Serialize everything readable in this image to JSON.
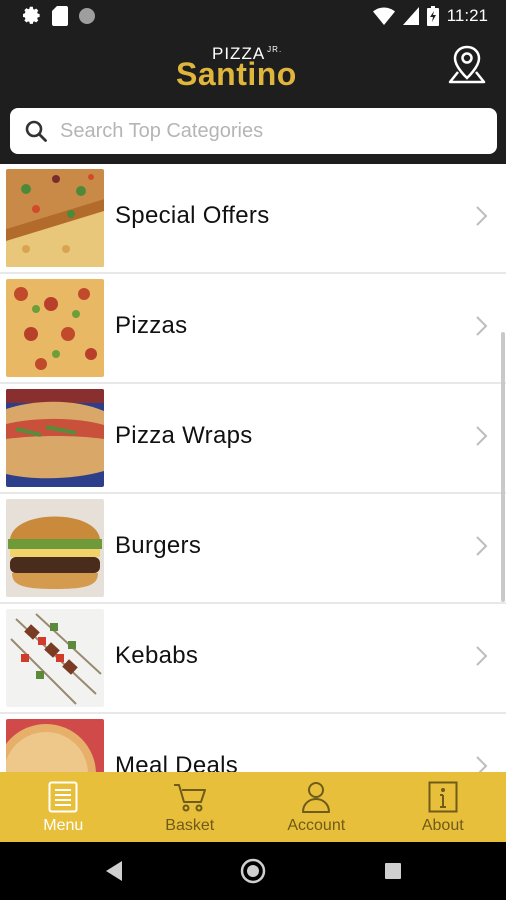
{
  "status_bar": {
    "time": "11:21",
    "icons": [
      "settings-icon",
      "sd-card-icon",
      "circle-notification-icon",
      "wifi-icon",
      "signal-icon",
      "battery-icon"
    ]
  },
  "header": {
    "logo_small": "PIZZA",
    "logo_small_suffix": "JR.",
    "logo_big": "Santino",
    "location_icon": "map-pin-icon",
    "brand_color": "#e0b53b"
  },
  "search": {
    "placeholder": "Search Top Categories",
    "value": ""
  },
  "categories": [
    {
      "label": "Special Offers",
      "image": "pizza-slices-photo"
    },
    {
      "label": "Pizzas",
      "image": "pizza-photo"
    },
    {
      "label": "Pizza Wraps",
      "image": "calzone-photo"
    },
    {
      "label": "Burgers",
      "image": "burger-photo"
    },
    {
      "label": "Kebabs",
      "image": "kebab-skewers-photo"
    },
    {
      "label": "Meal Deals",
      "image": "pizza-meal-photo"
    }
  ],
  "bottom_nav": {
    "color": "#e8bf3a",
    "items": [
      {
        "label": "Menu",
        "icon": "menu-icon",
        "active": true
      },
      {
        "label": "Basket",
        "icon": "basket-icon",
        "active": false
      },
      {
        "label": "Account",
        "icon": "account-icon",
        "active": false
      },
      {
        "label": "About",
        "icon": "info-icon",
        "active": false
      }
    ]
  },
  "android_nav": {
    "icons": [
      "back-icon",
      "home-icon",
      "recents-icon"
    ]
  }
}
